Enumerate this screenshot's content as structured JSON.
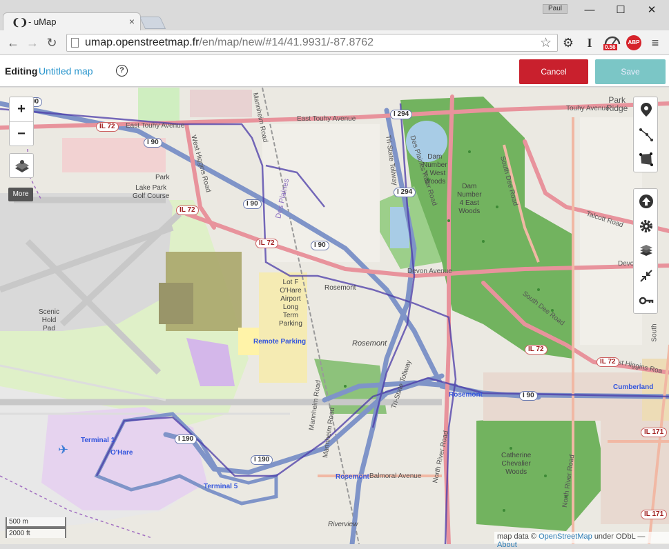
{
  "browser": {
    "tab_title": "- uMap",
    "tab_close": "×",
    "profile_name": "Paul",
    "window_controls": {
      "minimize": "—",
      "maximize": "☐",
      "close": "✕"
    },
    "url_host": "umap.openstreetmap.fr",
    "url_path": "/en/map/new/#14/41.9931/-87.8762",
    "extension_badge": "0.56",
    "adblock_label": "ABP"
  },
  "umap": {
    "editing_label": "Editing",
    "map_name": "Untitled map",
    "help_glyph": "?",
    "cancel_label": "Cancel",
    "save_label": "Save"
  },
  "controls": {
    "zoom_in": "+",
    "zoom_out": "−",
    "more_label": "More"
  },
  "scale": {
    "metric": "500 m",
    "imperial": "2000 ft"
  },
  "attribution": {
    "prefix": "map data ©",
    "osm": "OpenStreetMap",
    "license": "under ODbL",
    "sep": "—",
    "about": "About"
  },
  "map_labels": {
    "park": "Park",
    "lake_park": "Lake Park\nGolf Course",
    "park_ridge": "Park\nRidge",
    "dam4w": "Dam\nNumber\n4 West\nWoods",
    "dam4e": "Dam\nNumber\n4 East\nWoods",
    "scenic": "Scenic\nHold\nPad",
    "lotf": "Lot F\nO'Hare\nAirport\nLong\nTerm\nParking",
    "rosemont_small": "Rosemont",
    "rosemont": "Rosemont",
    "catherine": "Catherine\nChevalier\nWoods",
    "touhy": "East Touhy Avenue",
    "touhy2": "Touhy Avenue",
    "devon": "Devon Avenue",
    "devon2": "Devo",
    "talcott": "Talcott Road",
    "whiggins": "West Higgins Road",
    "whiggins2": "West Higgins Roa",
    "sdee": "South Dee Road",
    "sdee2": "South Dee Road",
    "mannheim": "Mannheim Road",
    "mannheim2": "Mannheim Road",
    "mannheim3": "Mannheim Road",
    "desplaines": "Des Plaines River Road",
    "tristate": "Tri-State Tollway",
    "nriver": "North River Road",
    "nriver2": "North River Road",
    "balmoral": "Balmoral Avenue",
    "riverview": "Riverview",
    "desplaines_city": "Des Plaines",
    "south": "South"
  },
  "transit_labels": {
    "remote_parking": "Remote Parking",
    "terminal1": "Terminal 1",
    "ohare": "O'Hare",
    "terminal5": "Terminal 5",
    "rosemont_station": "Rosemont",
    "rosemont_station2": "Rosemont",
    "cumberland": "Cumberland"
  },
  "shields": {
    "i90a": "I 90",
    "i90b": "I 90",
    "i90c": "I 90",
    "i90d": "I 90",
    "i90e": "I 90",
    "i190a": "I 190",
    "i190b": "I 190",
    "i294": "I 294",
    "i294b": "I 294",
    "il72a": "IL 72",
    "il72b": "IL 72",
    "il72c": "IL 72",
    "il72d": "IL 72",
    "il72e": "IL 72",
    "il171a": "IL 171",
    "il171b": "IL 171",
    "i90top": "90"
  },
  "colors": {
    "cancel": "#c9202d",
    "save": "#7bc6c6",
    "link": "#2a96cd",
    "motorway": "#7f94c8",
    "primary": "#e8939c",
    "park": "#74b567",
    "water": "#a8cce6",
    "apron": "#d4c1e4"
  },
  "icons": [
    "search-icon",
    "marker-icon",
    "polyline-icon",
    "polygon-icon",
    "upload-icon",
    "gear-icon",
    "layers-icon",
    "collapse-icon",
    "key-icon"
  ]
}
